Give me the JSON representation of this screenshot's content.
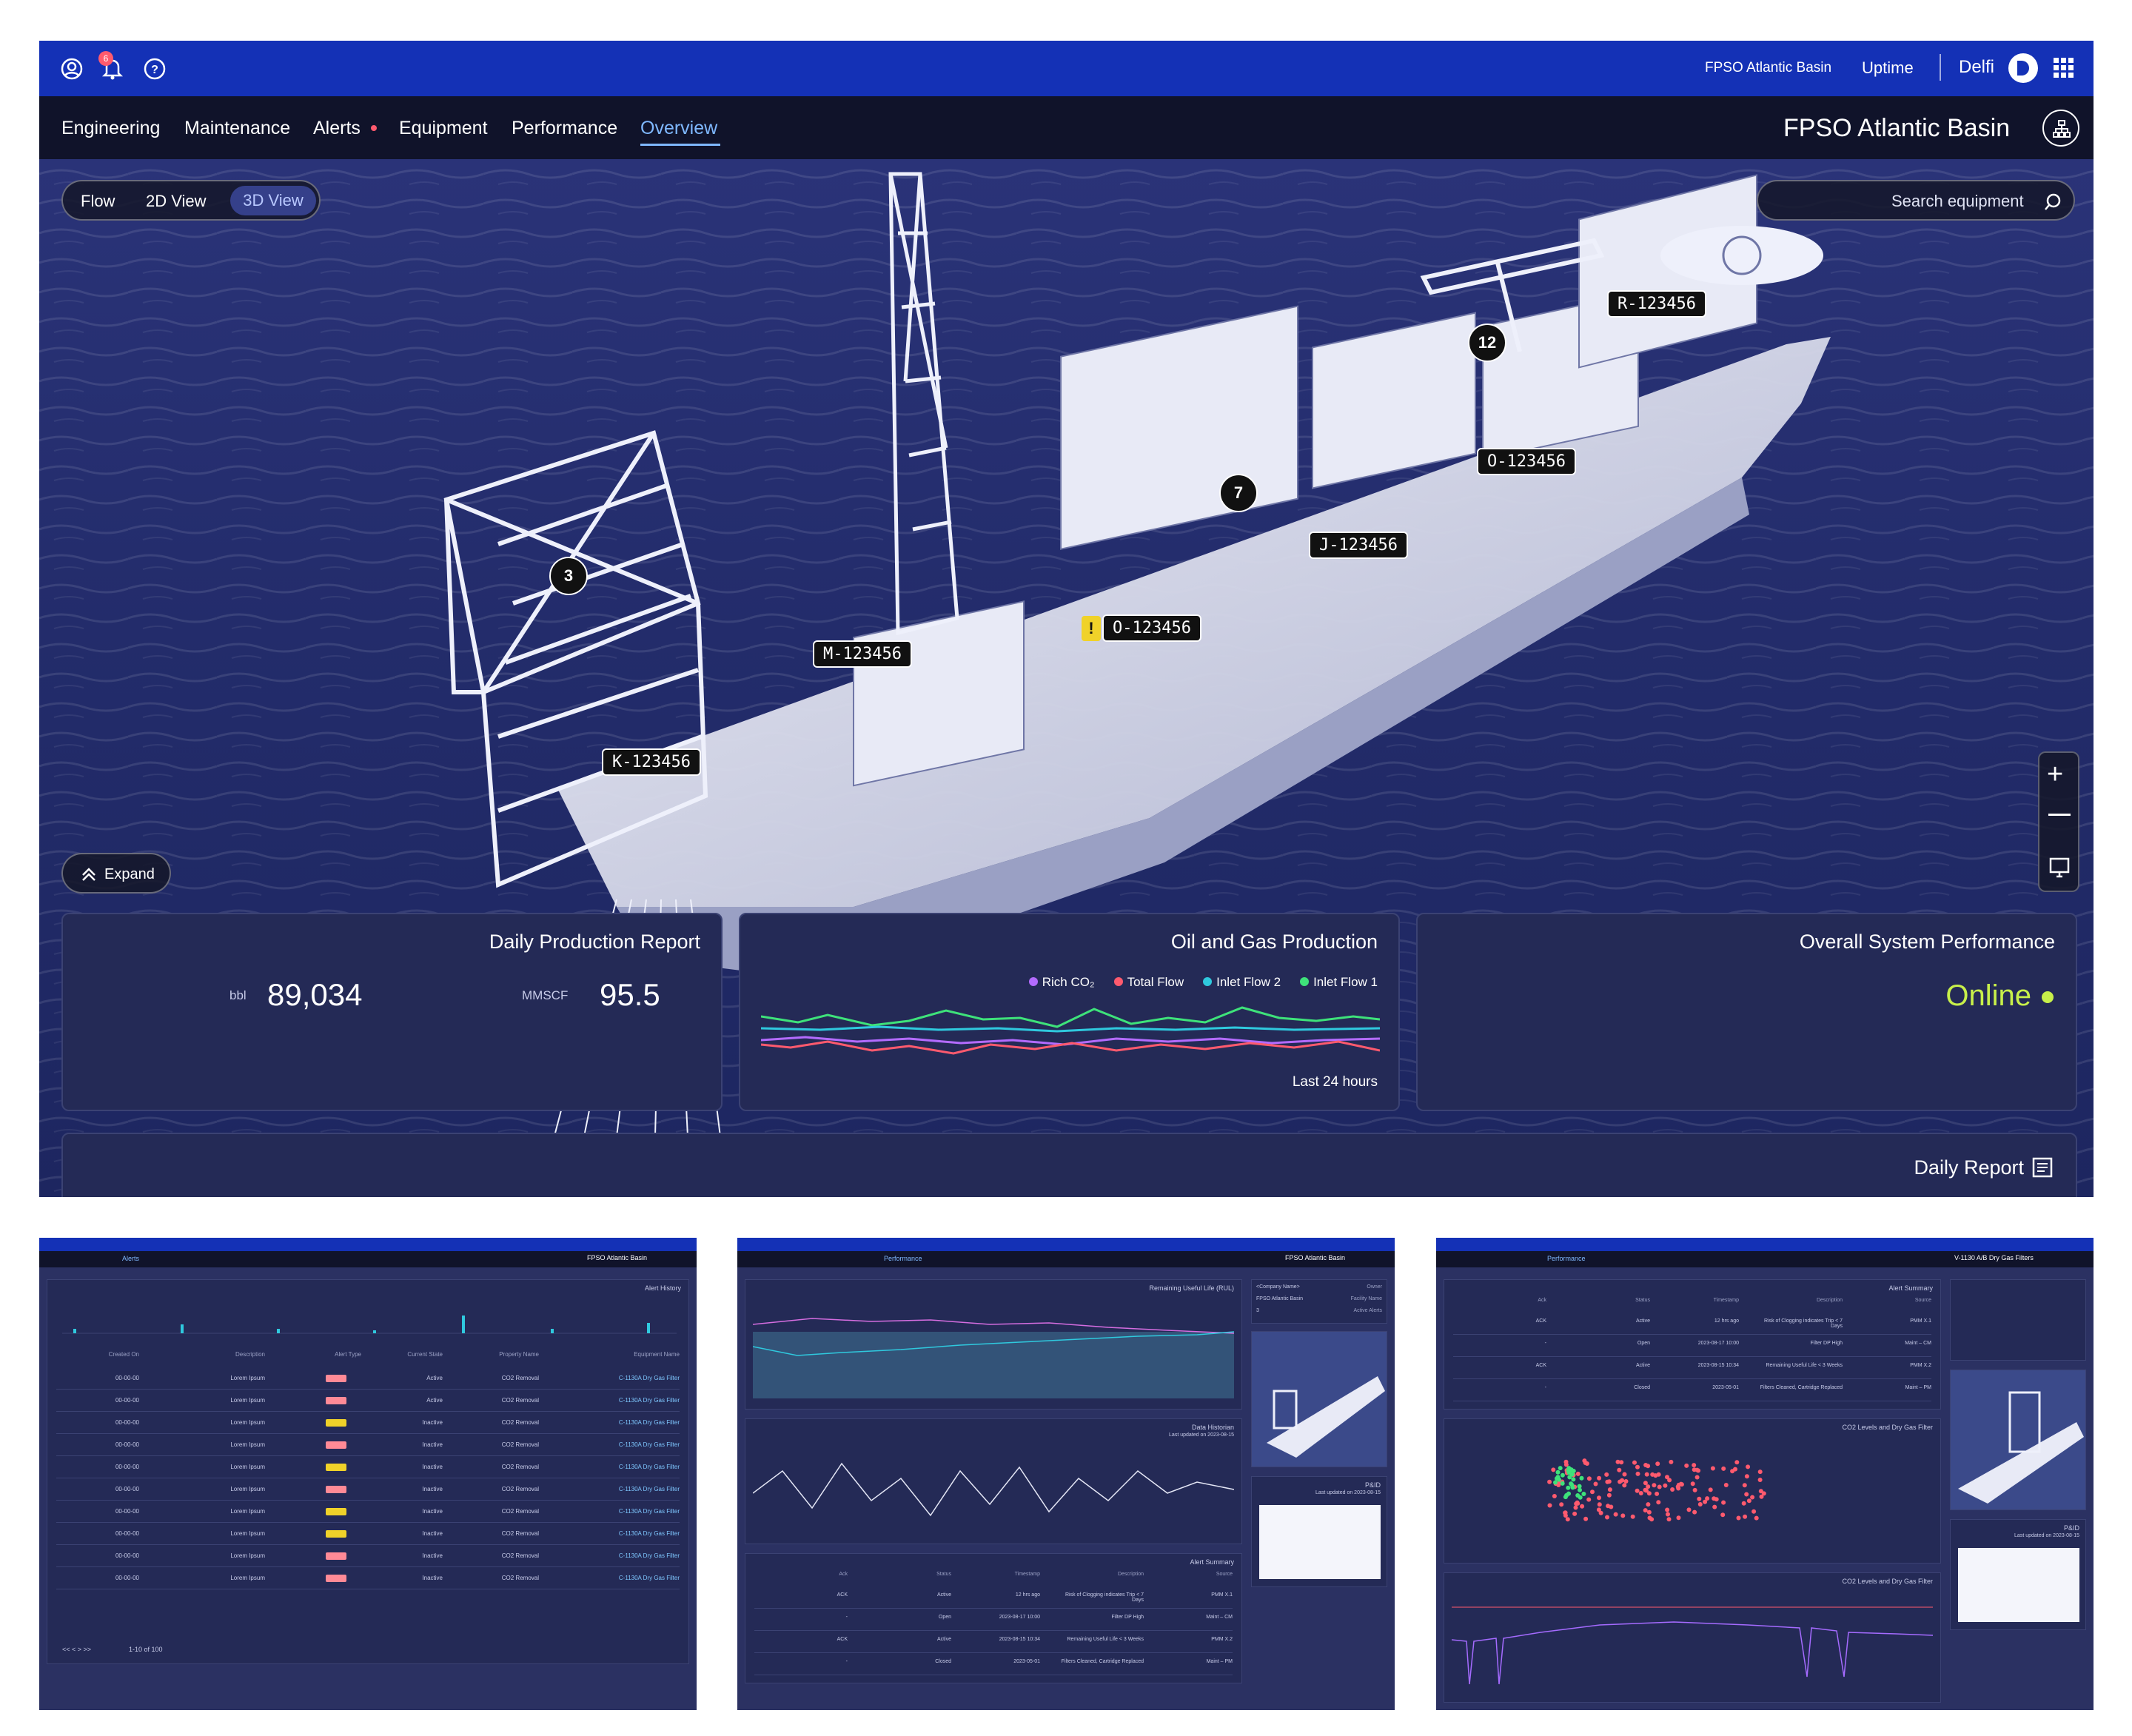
{
  "topbar": {
    "app_name": "Delfi",
    "module": "Uptime",
    "asset": "FPSO Atlantic Basin",
    "notification_count": "6"
  },
  "nav": {
    "title": "FPSO Atlantic Basin",
    "tabs": [
      "Overview",
      "Performance",
      "Equipment",
      "Alerts",
      "Maintenance",
      "Engineering"
    ],
    "active_tab": "Overview"
  },
  "view_toggle": {
    "options": [
      "3D View",
      "2D View",
      "Flow"
    ],
    "active": "3D View"
  },
  "search": {
    "placeholder": "Search equipment"
  },
  "markers": {
    "tags": [
      "R-123456",
      "O-123456",
      "J-123456",
      "O-123456",
      "M-123456",
      "K-123456"
    ],
    "counts": [
      "12",
      "7",
      "3"
    ],
    "warning": "!"
  },
  "expand": {
    "label": "Expand"
  },
  "overall": {
    "title": "Overall System Performance",
    "status": "Online",
    "status_color": "#c8f04a"
  },
  "oil_gas": {
    "title": "Oil and Gas Production",
    "legend": [
      {
        "label": "Inlet Flow 1",
        "color": "#3ee27a"
      },
      {
        "label": "Inlet Flow 2",
        "color": "#2fc9de"
      },
      {
        "label": "Total Flow",
        "color": "#ff5a6e"
      },
      {
        "label": "Rich CO₂",
        "color": "#b36bff"
      }
    ],
    "footer": "Last 24 hours"
  },
  "daily_production": {
    "title": "Daily Production Report",
    "value1": "89,034",
    "unit1": "bbl",
    "value2": "95.5",
    "unit2": "MMSCF"
  },
  "daily_report": {
    "title": "Daily Report"
  },
  "thumb1": {
    "tab_active": "Alerts",
    "panel_title": "Alert History",
    "headers": [
      "Equipment Name",
      "Property Name",
      "Current State",
      "Alert Type",
      "Description",
      "Created On"
    ],
    "rows": [
      {
        "name": "C-1130A Dry Gas Filter",
        "prop": "CO2 Removal",
        "state": "Active",
        "type": "red",
        "desc": "Lorem Ipsum",
        "date": "00-00-00"
      },
      {
        "name": "C-1130A Dry Gas Filter",
        "prop": "CO2 Removal",
        "state": "Active",
        "type": "red",
        "desc": "Lorem Ipsum",
        "date": "00-00-00"
      },
      {
        "name": "C-1130A Dry Gas Filter",
        "prop": "CO2 Removal",
        "state": "Inactive",
        "type": "yellow",
        "desc": "Lorem Ipsum",
        "date": "00-00-00"
      },
      {
        "name": "C-1130A Dry Gas Filter",
        "prop": "CO2 Removal",
        "state": "Inactive",
        "type": "red",
        "desc": "Lorem Ipsum",
        "date": "00-00-00"
      },
      {
        "name": "C-1130A Dry Gas Filter",
        "prop": "CO2 Removal",
        "state": "Inactive",
        "type": "yellow",
        "desc": "Lorem Ipsum",
        "date": "00-00-00"
      },
      {
        "name": "C-1130A Dry Gas Filter",
        "prop": "CO2 Removal",
        "state": "Inactive",
        "type": "red",
        "desc": "Lorem Ipsum",
        "date": "00-00-00"
      },
      {
        "name": "C-1130A Dry Gas Filter",
        "prop": "CO2 Removal",
        "state": "Inactive",
        "type": "yellow",
        "desc": "Lorem Ipsum",
        "date": "00-00-00"
      },
      {
        "name": "C-1130A Dry Gas Filter",
        "prop": "CO2 Removal",
        "state": "Inactive",
        "type": "yellow",
        "desc": "Lorem Ipsum",
        "date": "00-00-00"
      },
      {
        "name": "C-1130A Dry Gas Filter",
        "prop": "CO2 Removal",
        "state": "Inactive",
        "type": "red",
        "desc": "Lorem Ipsum",
        "date": "00-00-00"
      },
      {
        "name": "C-1130A Dry Gas Filter",
        "prop": "CO2 Removal",
        "state": "Inactive",
        "type": "red",
        "desc": "Lorem Ipsum",
        "date": "00-00-00"
      }
    ],
    "pager": "1-10 of 100"
  },
  "thumb2": {
    "tab_active": "Performance",
    "rul_title": "Remaining Useful Life (RUL)",
    "data_title": "Data Historian",
    "data_sub": "Last updated on 2023-08-15",
    "alert_title": "Alert Summary",
    "alert_headers": [
      "Source",
      "Description",
      "Timestamp",
      "Status",
      "Ack"
    ],
    "alert_rows": [
      {
        "src": "PMM X.1",
        "desc": "Risk of Clogging indicates Trip < 7 Days",
        "ts": "12 hrs ago",
        "status": "Active",
        "ack": "ACK"
      },
      {
        "src": "Maint – CM",
        "desc": "Filter DP High",
        "ts": "2023-08-17 10:00",
        "status": "Open",
        "ack": "-"
      },
      {
        "src": "PMM X.2",
        "desc": "Remaining Useful Life < 3 Weeks",
        "ts": "2023-08-15 10:34",
        "status": "Active",
        "ack": "ACK"
      },
      {
        "src": "Maint – PM",
        "desc": "Filters Cleaned, Cartridge Replaced",
        "ts": "2023-05-01",
        "status": "Closed",
        "ack": "-"
      }
    ],
    "pid_title": "P&ID",
    "pid_sub": "Last updated on 2023-08-15",
    "info_labels": [
      "Owner",
      "Facility Name",
      "Active Alerts"
    ],
    "info_values": [
      "<Company Name>",
      "FPSO Atlantic Basin",
      "3"
    ]
  },
  "thumb3": {
    "tab_active": "Performance",
    "title": "V-1130 A/B Dry Gas Filters",
    "summary_title": "Alert Summary",
    "scatter_title": "CO2 Levels and Dry Gas Filter",
    "line_title": "CO2 Levels and Dry Gas Filter",
    "pid_title": "P&ID",
    "pid_sub": "Last updated on 2023-08-15"
  }
}
